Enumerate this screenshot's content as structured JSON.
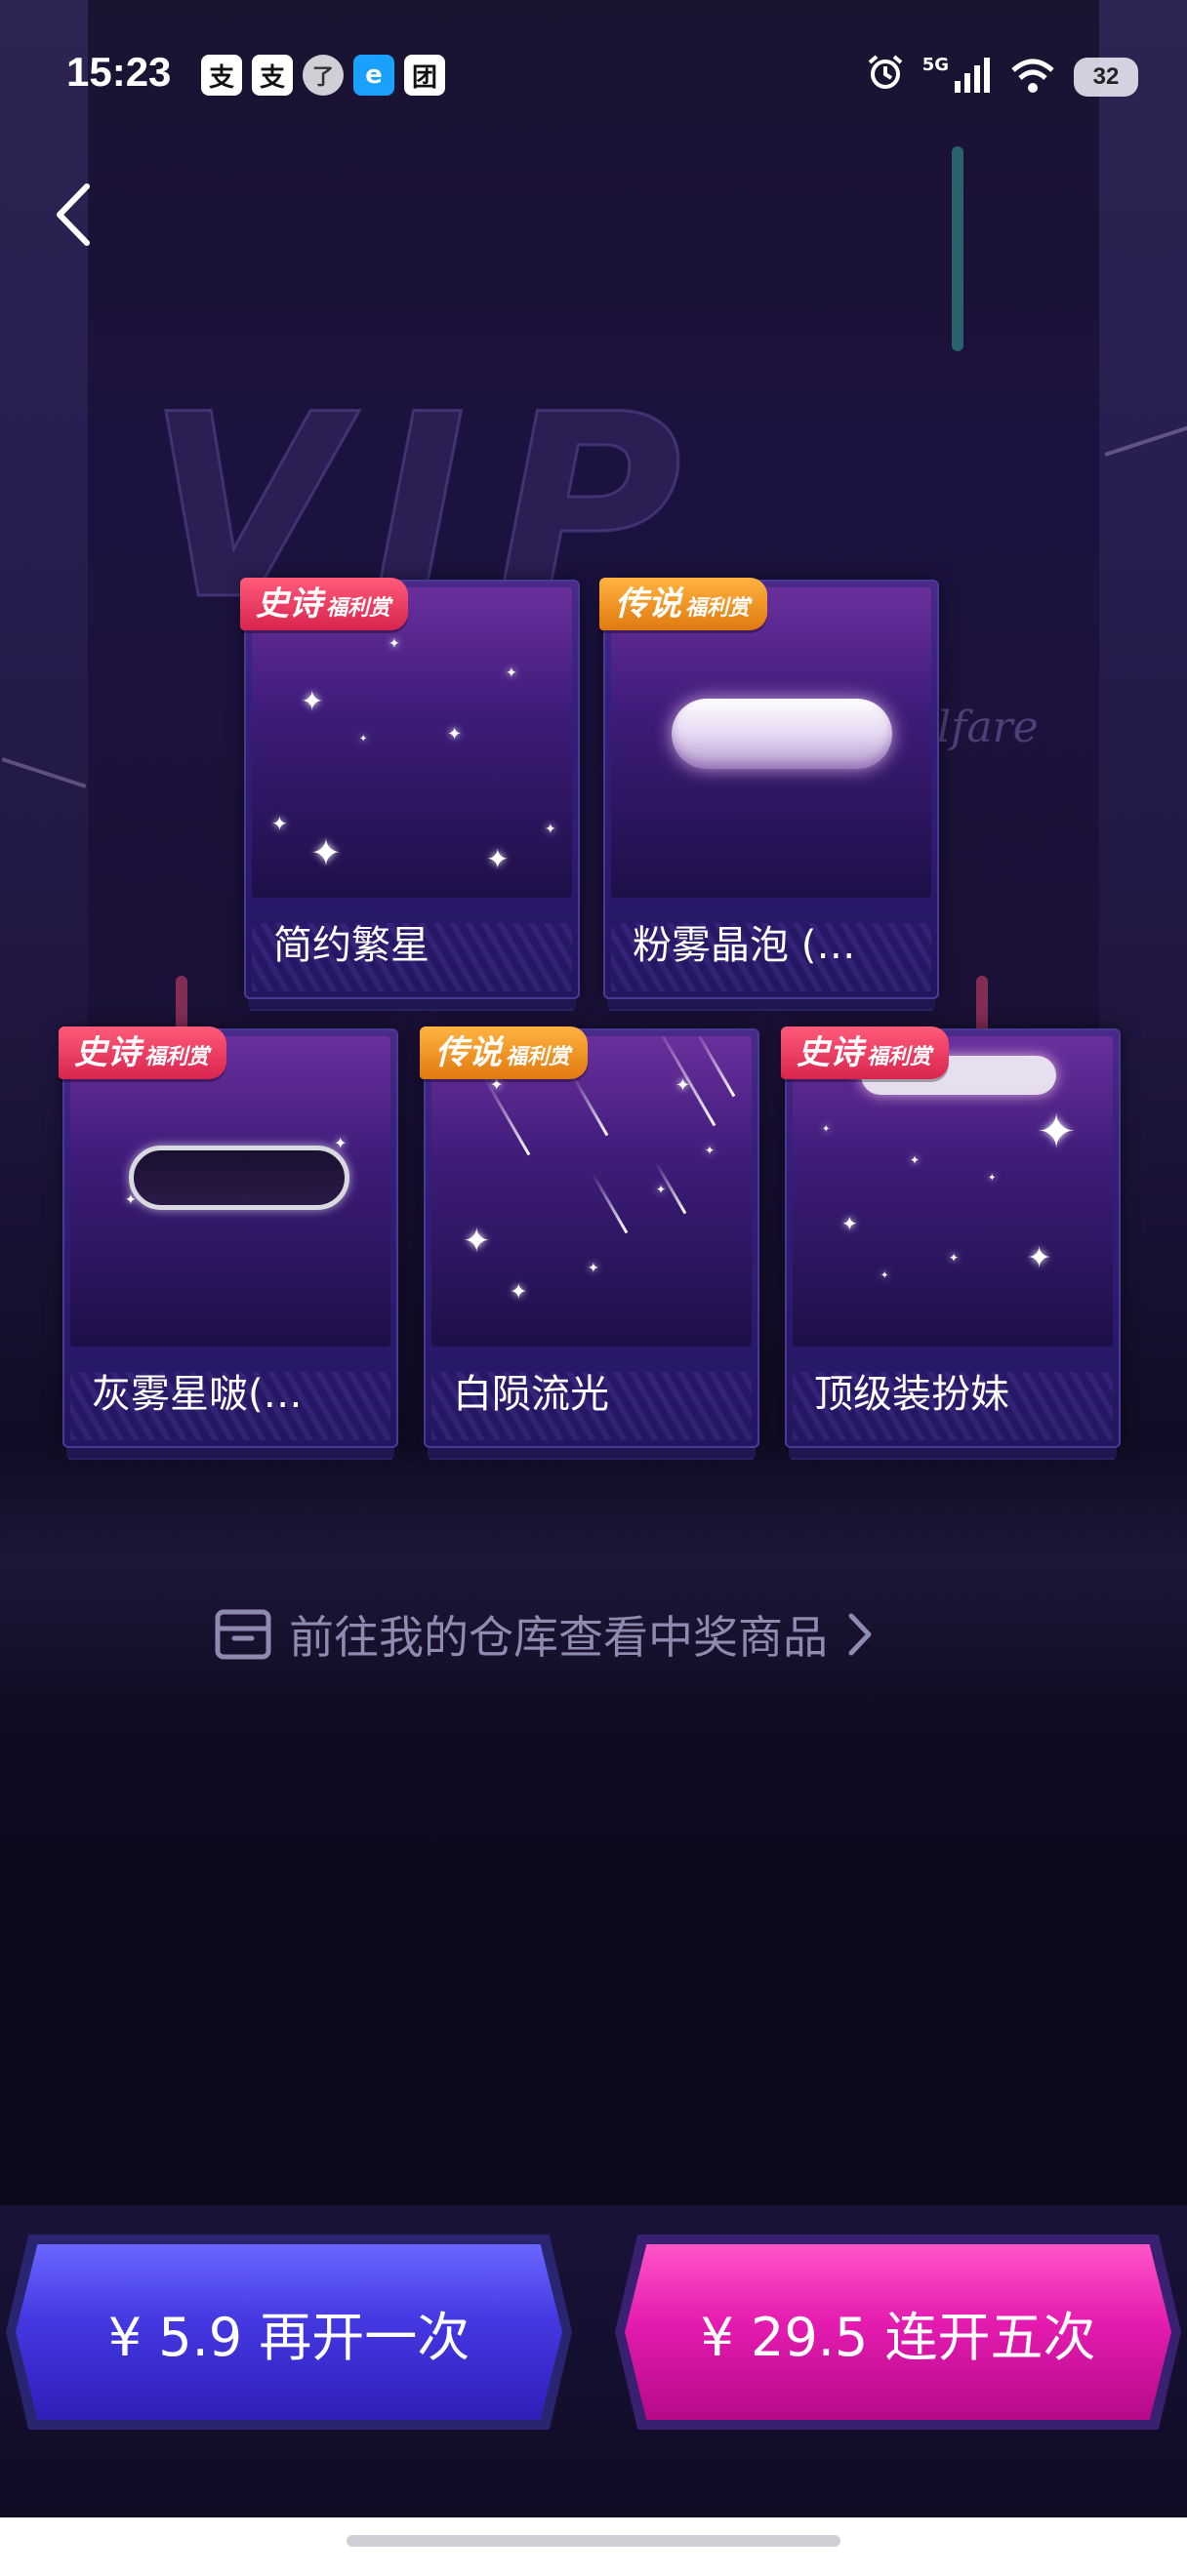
{
  "status_bar": {
    "time": "15:23",
    "app_icons": [
      "支",
      "支",
      "了",
      "e",
      "团"
    ],
    "network_label": "5G",
    "battery": "32"
  },
  "prizes": [
    {
      "tier": "史诗",
      "tier_sub": "福利赏",
      "tier_type": "epic",
      "name": "简约繁星"
    },
    {
      "tier": "传说",
      "tier_sub": "福利赏",
      "tier_type": "legend",
      "name": "粉雾晶泡 (…"
    },
    {
      "tier": "史诗",
      "tier_sub": "福利赏",
      "tier_type": "epic",
      "name": "灰雾星啵(…"
    },
    {
      "tier": "传说",
      "tier_sub": "福利赏",
      "tier_type": "legend",
      "name": "白陨流光"
    },
    {
      "tier": "史诗",
      "tier_sub": "福利赏",
      "tier_type": "epic",
      "name": "顶级装扮妹"
    }
  ],
  "warehouse_link": "前往我的仓库查看中奖商品",
  "buttons": {
    "open_once": "¥ 5.9 再开一次",
    "open_five": "¥ 29.5 连开五次"
  },
  "colors": {
    "epic": "#e0325a",
    "legend": "#f0901e",
    "open_once": "#4a3ee8",
    "open_five": "#e21bb0"
  }
}
